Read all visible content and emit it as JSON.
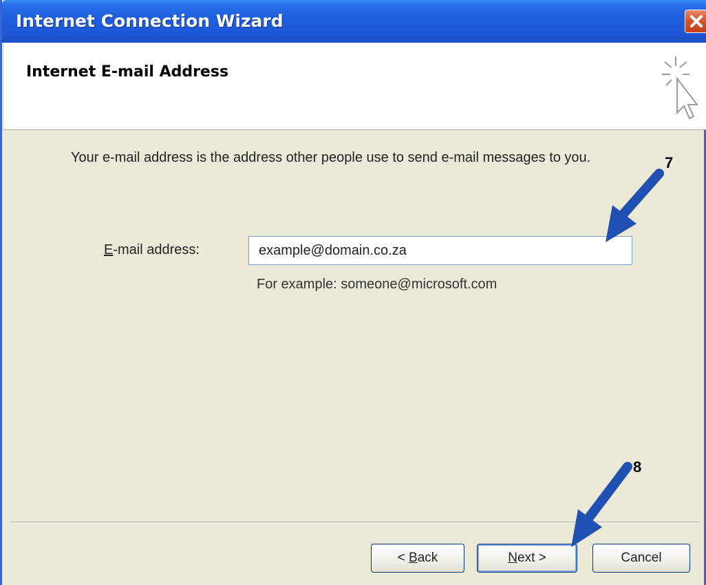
{
  "window": {
    "title": "Internet Connection Wizard"
  },
  "header": {
    "title": "Internet E-mail Address",
    "icon": "wizard-cursor-icon"
  },
  "body": {
    "intro": "Your e-mail address is the address other people use to send e-mail messages to you.",
    "email_label_mnemonic": "E",
    "email_label_rest": "-mail address:",
    "email_value": "example@domain.co.za",
    "example_hint": "For example: someone@microsoft.com"
  },
  "buttons": {
    "back_prefix": "< ",
    "back_mnemonic": "B",
    "back_rest": "ack",
    "next_mnemonic": "N",
    "next_rest": "ext >",
    "cancel": "Cancel"
  },
  "annotations": {
    "step7": "7",
    "step8": "8"
  },
  "colors": {
    "titlebar": "#1f5fe0",
    "dialog_bg": "#ece9d8",
    "annotation_arrow": "#2150b3"
  }
}
